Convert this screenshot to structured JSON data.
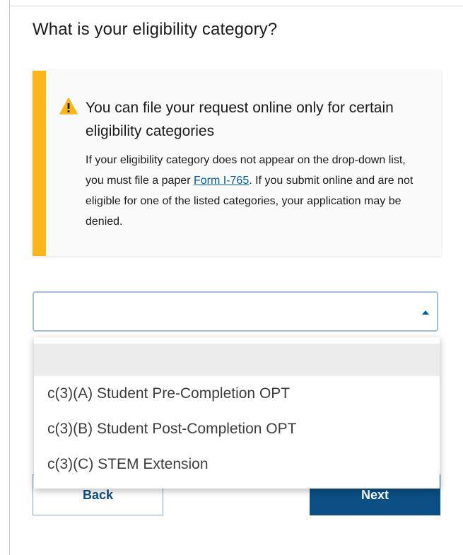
{
  "question": "What is your eligibility category?",
  "alert": {
    "heading": "You can file your request online only for certain eligibility categories",
    "body_before": "If your eligibility category does not appear on the drop-down list, you must file a paper ",
    "link": "Form I-765",
    "body_after": ". If you submit online and are not eligible for one of the listed categories, your application may be denied.",
    "icon": "warning-icon",
    "accent": "#fab51a"
  },
  "select": {
    "value": "",
    "caret_icon": "caret-up-icon",
    "options": [
      "",
      "c(3)(A) Student Pre-Completion OPT",
      "c(3)(B) Student Post-Completion OPT",
      "c(3)(C) STEM Extension"
    ]
  },
  "buttons": {
    "back": "Back",
    "next": "Next"
  },
  "colors": {
    "primary": "#0b4f84",
    "link": "#005ea2"
  }
}
